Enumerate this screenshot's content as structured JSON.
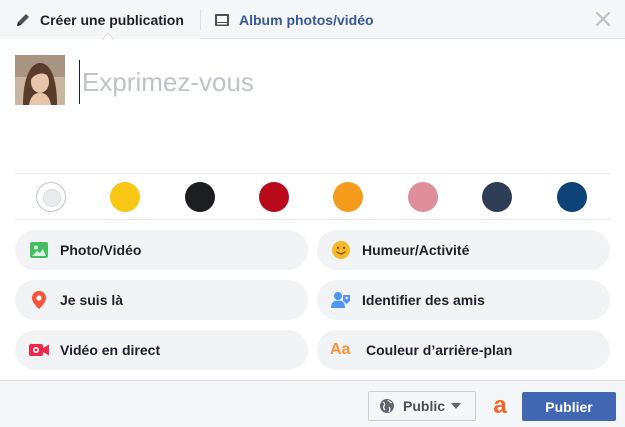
{
  "tabs": {
    "create": {
      "label": "Créer une publication",
      "icon": "pencil-icon"
    },
    "album": {
      "label": "Album photos/vidéo",
      "icon": "photo-album-icon"
    },
    "close_icon": "close-icon"
  },
  "composer": {
    "placeholder": "Exprimez-vous",
    "value": "",
    "avatar": "user-avatar"
  },
  "background_colors": {
    "selected": "white",
    "swatches": [
      "#ffffff",
      "#f7c714",
      "#1c1e21",
      "#b90a1c",
      "#f59c1c",
      "#df8f9b",
      "#2e3d55",
      "#0d4377"
    ]
  },
  "actions": [
    {
      "label": "Photo/Vidéo",
      "icon": "photo-icon"
    },
    {
      "label": "Humeur/Activité",
      "icon": "smiley-icon"
    },
    {
      "label": "Je suis là",
      "icon": "location-pin-icon"
    },
    {
      "label": "Identifier des amis",
      "icon": "tag-friends-icon"
    },
    {
      "label": "Vidéo en direct",
      "icon": "live-video-icon"
    },
    {
      "label": "Couleur d’arrière-plan",
      "icon": "text-color-icon",
      "icon_text": "Aa"
    }
  ],
  "footer": {
    "privacy_label": "Public",
    "privacy_icon": "globe-icon",
    "brand_icon": "brand-a-icon",
    "brand_glyph": "a",
    "publish_label": "Publier"
  },
  "colors": {
    "accent": "#4267b2",
    "link": "#365899",
    "action_bg": "#f2f3f5"
  }
}
